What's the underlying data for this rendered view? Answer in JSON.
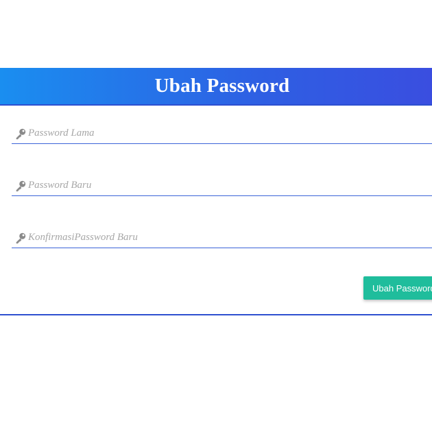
{
  "header": {
    "title": "Ubah Password"
  },
  "form": {
    "fields": [
      {
        "name": "password-lama",
        "icon": "key-icon",
        "placeholder": "Password Lama",
        "value": ""
      },
      {
        "name": "password-baru",
        "icon": "key-icon",
        "placeholder": "Password Baru",
        "value": ""
      },
      {
        "name": "konfirmasi-password-baru",
        "icon": "key-icon",
        "placeholder": "KonfirmasiPassword Baru",
        "value": ""
      }
    ],
    "submit_label": "Ubah Password"
  },
  "colors": {
    "header_gradient_start": "#1a8ef0",
    "header_gradient_end": "#3a4ee0",
    "field_underline": "#3a63d8",
    "button_bg": "#1fbd9c",
    "divider": "#2d4fd0",
    "placeholder": "#a7a7a7"
  }
}
